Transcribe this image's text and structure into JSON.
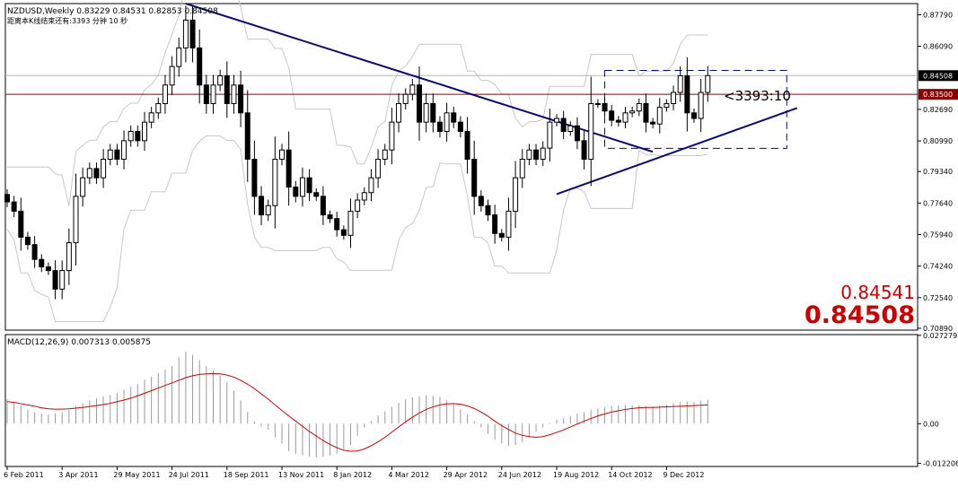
{
  "colors": {
    "background": "#ffffff",
    "grid": "#000000",
    "candle_bull_body": "#ffffff",
    "candle_bear_body": "#000000",
    "candle_outline": "#000000",
    "envelope": "#c8c8c8",
    "trendline": "#0a0a78",
    "box": "#0a0a78",
    "hline_current": "#8b0000",
    "hline_bid": "#b4b4b4",
    "price_tag_red": "#cc0000",
    "macd_hist": "#9a9a9a",
    "macd_signal": "#cc0000",
    "text": "#000000"
  },
  "chart_data": [
    {
      "type": "candlestick",
      "panel": "main",
      "symbol_line": "NZDUSD,Weekly  0.83229 0.84531 0.82853 0.84508",
      "info_line": "距离本K线结束还有:3393 分钟 10 秒",
      "countdown_label": "<3393:10",
      "big_labels": [
        "0.84541",
        "0.84508"
      ],
      "y_ticks": [
        "0.87790",
        "0.86090",
        "0.84508",
        "0.83500",
        "0.82690",
        "0.80990",
        "0.79340",
        "0.77640",
        "0.75940",
        "0.74240",
        "0.72540",
        "0.70890"
      ],
      "y_tick_values": [
        0.8779,
        0.8609,
        0.84508,
        0.835,
        0.8269,
        0.8099,
        0.7934,
        0.7764,
        0.7594,
        0.7424,
        0.7254,
        0.7089
      ],
      "ylim": [
        0.7079,
        0.8839
      ],
      "x_ticks": [
        "6 Feb 2011",
        "3 Apr 2011",
        "29 May 2011",
        "24 Jul 2011",
        "18 Sep 2011",
        "13 Nov 2011",
        "8 Jan 2012",
        "4 Mar 2012",
        "29 Apr 2012",
        "24 Jun 2012",
        "19 Aug 2012",
        "14 Oct 2012",
        "9 Dec 2012"
      ],
      "x_tick_bar_index": [
        0,
        8,
        16,
        24,
        32,
        40,
        48,
        56,
        64,
        72,
        80,
        88,
        96
      ],
      "horizontal_lines": [
        0.84508,
        0.835
      ],
      "close": [
        0.777,
        0.772,
        0.758,
        0.754,
        0.746,
        0.742,
        0.74,
        0.73,
        0.74,
        0.755,
        0.78,
        0.79,
        0.795,
        0.79,
        0.8,
        0.805,
        0.8,
        0.81,
        0.815,
        0.81,
        0.82,
        0.825,
        0.83,
        0.84,
        0.85,
        0.86,
        0.875,
        0.86,
        0.84,
        0.83,
        0.84,
        0.845,
        0.83,
        0.84,
        0.825,
        0.8,
        0.78,
        0.77,
        0.775,
        0.8,
        0.805,
        0.785,
        0.78,
        0.79,
        0.782,
        0.78,
        0.77,
        0.768,
        0.762,
        0.759,
        0.772,
        0.778,
        0.782,
        0.79,
        0.8,
        0.805,
        0.82,
        0.83,
        0.835,
        0.84,
        0.82,
        0.83,
        0.82,
        0.815,
        0.825,
        0.82,
        0.815,
        0.8,
        0.78,
        0.775,
        0.77,
        0.76,
        0.758,
        0.772,
        0.79,
        0.8,
        0.805,
        0.8,
        0.806,
        0.82,
        0.822,
        0.815,
        0.818,
        0.81,
        0.8,
        0.83,
        0.83,
        0.826,
        0.821,
        0.82,
        0.825,
        0.826,
        0.83,
        0.82,
        0.819,
        0.828,
        0.83,
        0.836,
        0.845,
        0.825,
        0.822,
        0.836,
        0.8451
      ]
    },
    {
      "type": "macd",
      "panel": "macd",
      "title": "MACD(12,26,9) 0.007313 0.005875",
      "y_ticks": [
        "0.027279",
        "0.00",
        "-0.012206"
      ],
      "y_tick_values": [
        0.027279,
        0.0,
        -0.012206
      ],
      "ylim": [
        -0.0132,
        0.0275
      ],
      "histogram": [
        0.0075,
        0.0068,
        0.0055,
        0.0042,
        0.0036,
        0.0031,
        0.0029,
        0.0032,
        0.0035,
        0.0042,
        0.0055,
        0.0063,
        0.0072,
        0.0078,
        0.0084,
        0.0088,
        0.0095,
        0.0105,
        0.0114,
        0.0123,
        0.0136,
        0.0145,
        0.0156,
        0.0168,
        0.0178,
        0.0205,
        0.0222,
        0.0213,
        0.0196,
        0.0178,
        0.0165,
        0.0148,
        0.0128,
        0.0102,
        0.0072,
        0.0036,
        0.0007,
        -0.0009,
        -0.0018,
        -0.0042,
        -0.0062,
        -0.0085,
        -0.0094,
        -0.0098,
        -0.0101,
        -0.0104,
        -0.0102,
        -0.0098,
        -0.0092,
        -0.0083,
        -0.0066,
        -0.0038,
        -0.0012,
        0.0008,
        0.0025,
        0.0038,
        0.0052,
        0.0064,
        0.0075,
        0.0082,
        0.0085,
        0.0088,
        0.0086,
        0.0083,
        0.0072,
        0.0059,
        0.0044,
        0.0028,
        0.0008,
        -0.0012,
        -0.0031,
        -0.0049,
        -0.0062,
        -0.0068,
        -0.0066,
        -0.0058,
        -0.0042,
        -0.0025,
        -0.0012,
        0.0002,
        0.0012,
        0.0018,
        0.0024,
        0.0031,
        0.0036,
        0.0042,
        0.0047,
        0.0051,
        0.0055,
        0.0057,
        0.0058,
        0.0057,
        0.0056,
        0.0054,
        0.0053,
        0.0056,
        0.0059,
        0.0064,
        0.0068,
        0.0069,
        0.0067,
        0.0071,
        0.0073
      ],
      "signal": [
        0.0068,
        0.0066,
        0.0062,
        0.0058,
        0.0054,
        0.0049,
        0.0046,
        0.0045,
        0.0045,
        0.0046,
        0.0048,
        0.005,
        0.0053,
        0.0056,
        0.0059,
        0.0063,
        0.0068,
        0.0073,
        0.0079,
        0.0086,
        0.0094,
        0.0102,
        0.011,
        0.0118,
        0.0126,
        0.0134,
        0.0142,
        0.0148,
        0.0152,
        0.0154,
        0.0155,
        0.0154,
        0.015,
        0.0144,
        0.0134,
        0.0122,
        0.0108,
        0.0092,
        0.0076,
        0.0058,
        0.0041,
        0.0024,
        0.0008,
        -0.0008,
        -0.0024,
        -0.0038,
        -0.0052,
        -0.0064,
        -0.0074,
        -0.0082,
        -0.0085,
        -0.0084,
        -0.0078,
        -0.0068,
        -0.0056,
        -0.0042,
        -0.0026,
        -0.001,
        0.0006,
        0.002,
        0.0033,
        0.0044,
        0.0052,
        0.0058,
        0.0061,
        0.0062,
        0.006,
        0.0055,
        0.0047,
        0.0036,
        0.0023,
        0.0008,
        -0.0006,
        -0.0018,
        -0.0029,
        -0.0036,
        -0.004,
        -0.0042,
        -0.004,
        -0.0034,
        -0.0027,
        -0.0019,
        -0.001,
        -0.0001,
        0.0008,
        0.0016,
        0.0024,
        0.003,
        0.0036,
        0.004,
        0.0044,
        0.0047,
        0.0049,
        0.005,
        0.005,
        0.0051,
        0.0052,
        0.0053,
        0.0054,
        0.0055,
        0.0056,
        0.0057,
        0.0058
      ]
    }
  ]
}
